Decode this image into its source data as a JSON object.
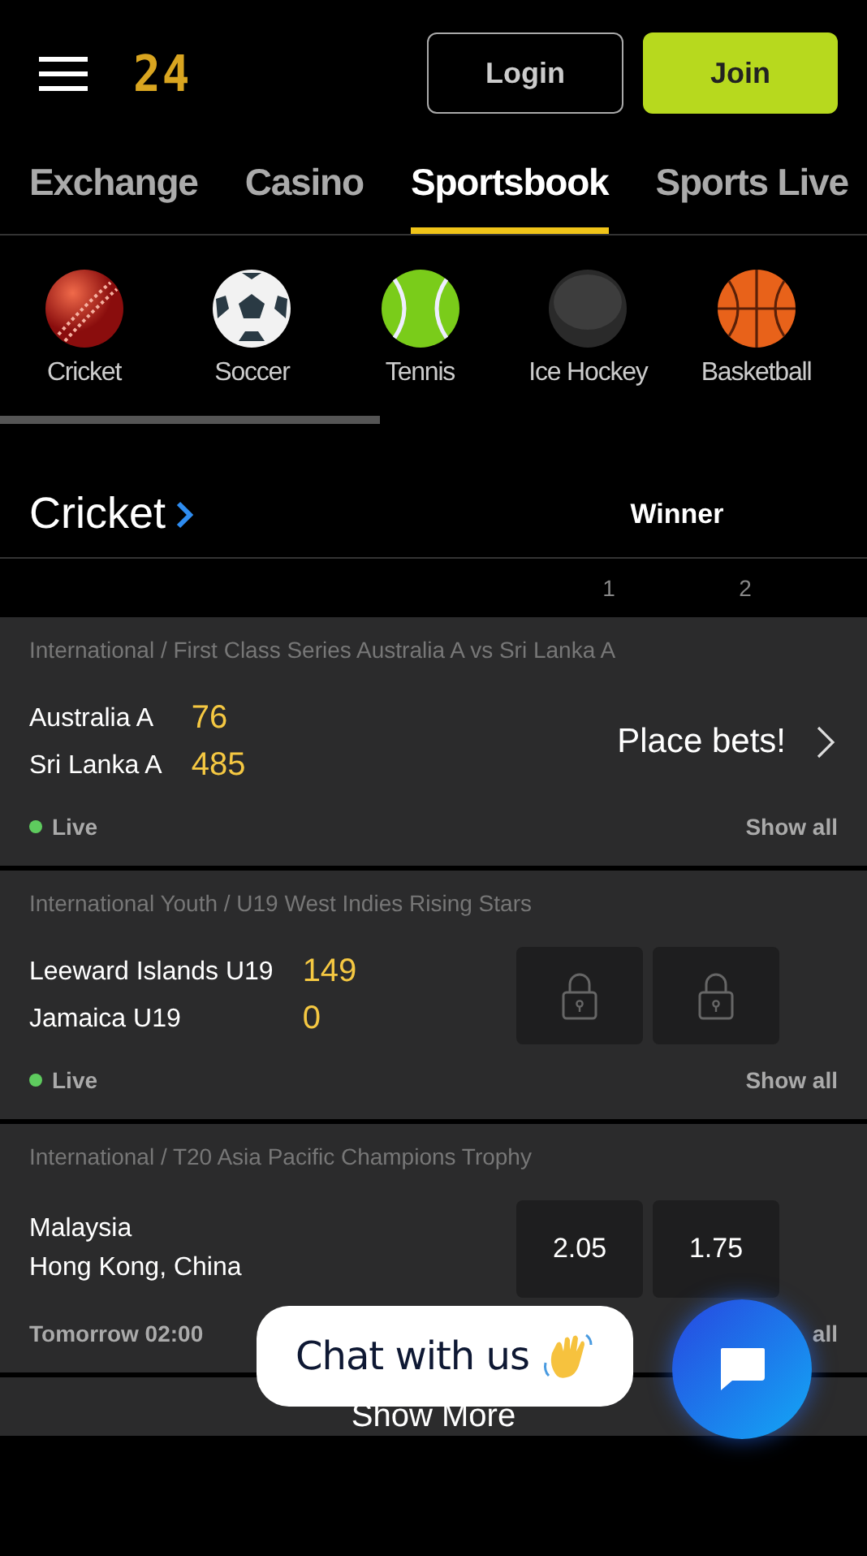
{
  "header": {
    "logo": "24",
    "buttons": [
      {
        "label": "Login",
        "kind": "outline"
      },
      {
        "label": "Join",
        "kind": "primary"
      }
    ]
  },
  "tabs": [
    {
      "label": "Exchange",
      "selected": false
    },
    {
      "label": "Casino",
      "selected": false
    },
    {
      "label": "Sportsbook",
      "selected": true
    },
    {
      "label": "Sports Live",
      "selected": false
    }
  ],
  "sports": [
    {
      "label": "Cricket",
      "kind": "cricket"
    },
    {
      "label": "Soccer",
      "kind": "soccer"
    },
    {
      "label": "Tennis",
      "kind": "tennis"
    },
    {
      "label": "Ice Hockey",
      "kind": "hockey"
    },
    {
      "label": "Basketball",
      "kind": "basketball"
    }
  ],
  "section": {
    "title": "Cricket",
    "market": "Winner",
    "columns": [
      "1",
      "2"
    ]
  },
  "matches": [
    {
      "competition": "International / First Class Series Australia A vs Sri Lanka A",
      "teams": [
        {
          "name": "Australia A",
          "score": "76"
        },
        {
          "name": "Sri Lanka A",
          "score": "485"
        }
      ],
      "kind": "promo",
      "promo": "Place bets!",
      "status": "Live",
      "live": true,
      "show_all": "Show all"
    },
    {
      "competition": "International Youth / U19 West Indies Rising Stars",
      "teams": [
        {
          "name": "Leeward Islands U19",
          "score": "149"
        },
        {
          "name": "Jamaica U19",
          "score": "0"
        }
      ],
      "kind": "locked",
      "status": "Live",
      "live": true,
      "show_all": "Show all"
    },
    {
      "competition": "International / T20 Asia Pacific Champions Trophy",
      "teams": [
        {
          "name": "Malaysia"
        },
        {
          "name": "Hong Kong, China"
        }
      ],
      "kind": "odds",
      "odds": [
        "2.05",
        "1.75"
      ],
      "status": "Tomorrow 02:00",
      "live": false,
      "show_all": "all"
    }
  ],
  "show_more": "Show More",
  "chat": {
    "label": "Chat with us"
  }
}
